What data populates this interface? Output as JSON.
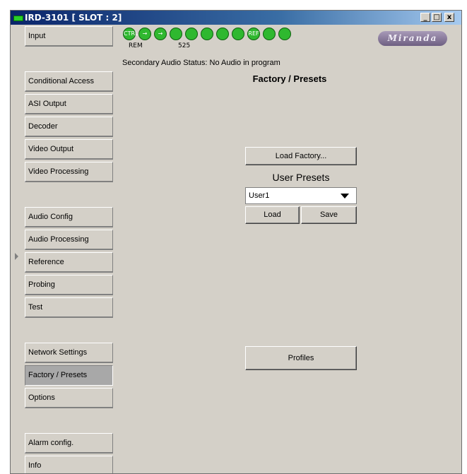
{
  "window": {
    "title": "IRD-3101 [ SLOT : 2]",
    "controls": {
      "minimize": "_",
      "maximize": "□",
      "close": "x"
    }
  },
  "sidebar": {
    "items": [
      {
        "label": "Input",
        "active": false
      },
      {
        "label": "Conditional Access",
        "active": false
      },
      {
        "label": "ASI Output",
        "active": false
      },
      {
        "label": "Decoder",
        "active": false
      },
      {
        "label": "Video Output",
        "active": false
      },
      {
        "label": "Video Processing",
        "active": false
      },
      {
        "label": "Audio Config",
        "active": false
      },
      {
        "label": "Audio Processing",
        "active": false
      },
      {
        "label": "Reference",
        "active": false
      },
      {
        "label": "Probing",
        "active": false
      },
      {
        "label": "Test",
        "active": false
      },
      {
        "label": "Network Settings",
        "active": false
      },
      {
        "label": "Factory / Presets",
        "active": true
      },
      {
        "label": "Options",
        "active": false
      },
      {
        "label": "Alarm config.",
        "active": false
      },
      {
        "label": "Info",
        "active": false
      }
    ]
  },
  "status": {
    "icons": [
      {
        "name": "ctrl-icon",
        "text": "CTRL"
      },
      {
        "name": "input-arrow-icon",
        "text": "→"
      },
      {
        "name": "output-arrow-icon",
        "text": "→"
      },
      {
        "name": "lock-icon",
        "text": ""
      },
      {
        "name": "audio-icon",
        "text": ""
      },
      {
        "name": "audio-status-icon",
        "text": ""
      },
      {
        "name": "audio-lock-icon",
        "text": ""
      },
      {
        "name": "delay-icon",
        "text": ""
      },
      {
        "name": "ref-icon",
        "text": "REF"
      },
      {
        "name": "video-icon",
        "text": ""
      },
      {
        "name": "ok-led-icon",
        "text": ""
      }
    ],
    "rem_label": "REM",
    "resolution_label": "525",
    "logo_text": "Miranda",
    "secondary_audio": "Secondary Audio Status: No Audio in program"
  },
  "panel": {
    "title": "Factory / Presets",
    "load_factory_label": "Load Factory...",
    "user_presets_label": "User Presets",
    "preset_selected": "User1",
    "load_label": "Load",
    "save_label": "Save",
    "profiles_label": "Profiles"
  },
  "colors": {
    "title_bar": "#0a246a",
    "status_green": "#2fb82f",
    "panel_bg": "#d4d0c8",
    "active_item_bg": "#a8a8a8"
  }
}
